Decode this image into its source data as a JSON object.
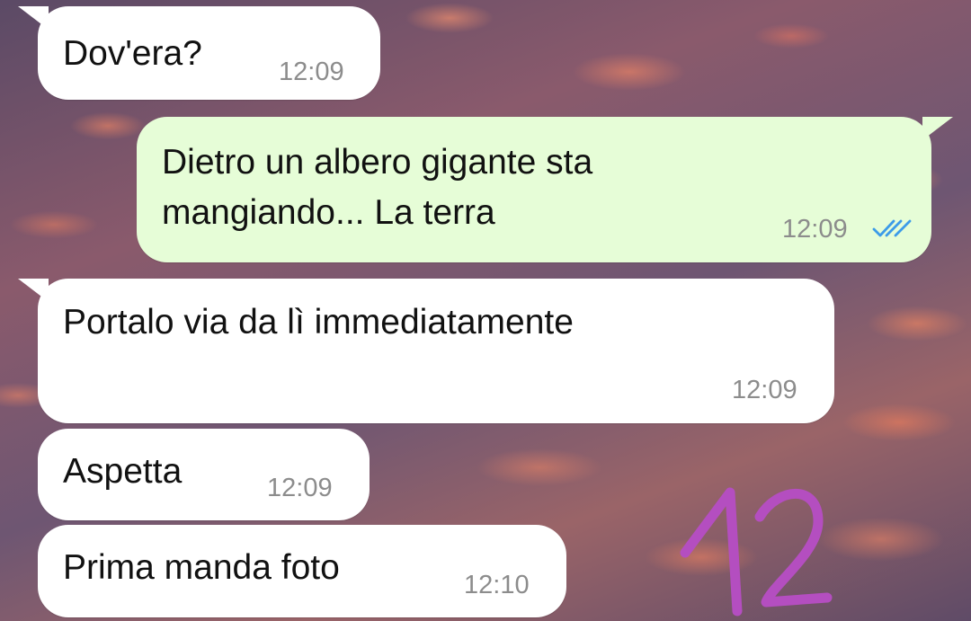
{
  "chat": {
    "messages": [
      {
        "direction": "incoming",
        "text": "Dov'era?",
        "time": "12:09"
      },
      {
        "direction": "outgoing",
        "text": "Dietro un albero gigante sta\nmangiando... La terra",
        "time": "12:09",
        "status_icon": "double-check-read-icon"
      },
      {
        "direction": "incoming",
        "text": "Portalo via da lì immediatamente",
        "time": "12:09"
      },
      {
        "direction": "incoming",
        "text": "Aspetta",
        "time": "12:09"
      },
      {
        "direction": "incoming",
        "text": "Prima manda foto",
        "time": "12:10"
      }
    ]
  },
  "overlay": {
    "handwritten_text": "12",
    "color": "#b44ec0"
  },
  "colors": {
    "incoming_bubble": "#ffffff",
    "outgoing_bubble": "#e6fdd7",
    "read_ticks": "#3c9be8",
    "timestamp": "#8c8c8c"
  }
}
